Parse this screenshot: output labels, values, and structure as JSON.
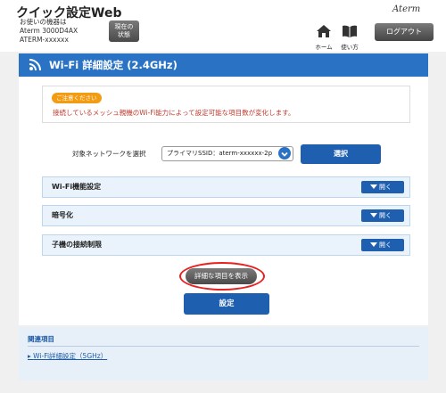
{
  "header": {
    "app_title": "クイック設定Web",
    "device_info": [
      "お使いの機器は",
      "Aterm 3000D4AX",
      "ATERM-xxxxxx"
    ],
    "status_button": [
      "現在の",
      "状態"
    ],
    "brand": "Aterm",
    "home_label": "ホーム",
    "help_label": "使い方",
    "logout_label": "ログアウト"
  },
  "panel": {
    "title": "Wi-Fi 詳細設定 (2.4GHz)",
    "notice_badge": "ご注意ください",
    "notice_text": "接続しているメッシュ親機のWi-Fi能力によって設定可能な項目数が変化します。",
    "network_select_label": "対象ネットワークを選択",
    "network_select_value": "プライマリSSID：aterm-xxxxxx-2p",
    "select_button": "選択",
    "sections": [
      {
        "title": "Wi-Fi機能設定",
        "toggle": "開く"
      },
      {
        "title": "暗号化",
        "toggle": "開く"
      },
      {
        "title": "子機の接続制限",
        "toggle": "開く"
      }
    ],
    "detail_button": "詳細な項目を表示",
    "set_button": "設定"
  },
  "related": {
    "title": "関連項目",
    "link": "Wi-Fi詳細設定（5GHz）"
  },
  "colors": {
    "accent": "#2a73c4",
    "button_blue": "#1f5fb0",
    "notice_red": "#c0392b",
    "badge_orange": "#f39c12",
    "highlight_ring": "#e8201f"
  }
}
